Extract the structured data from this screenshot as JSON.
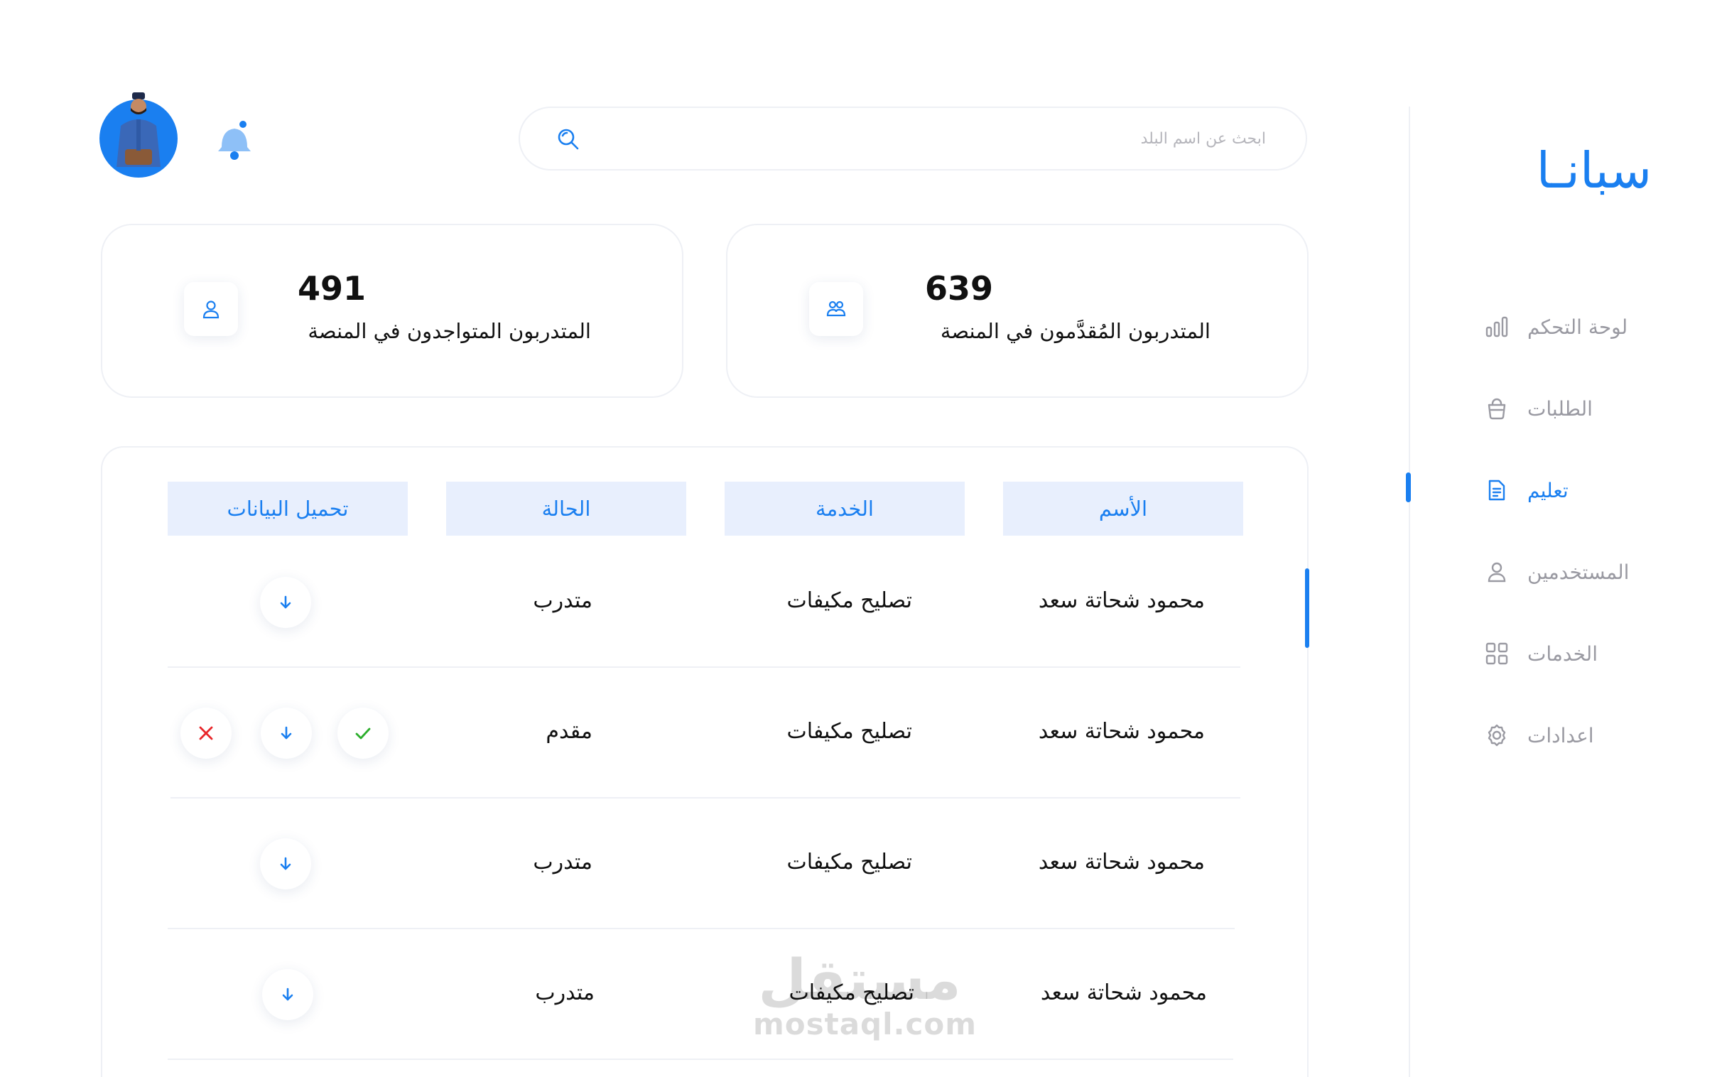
{
  "app": {
    "logo_text": "سبانـا",
    "accent_color": "#1a7ff0"
  },
  "sidebar": {
    "items": [
      {
        "label": "لوحة التحكم",
        "icon": "bar-chart-icon",
        "active": false
      },
      {
        "label": "الطلبات",
        "icon": "bag-icon",
        "active": false
      },
      {
        "label": "تعليم",
        "icon": "document-icon",
        "active": true
      },
      {
        "label": "المستخدمين",
        "icon": "user-icon",
        "active": false
      },
      {
        "label": "الخدمات",
        "icon": "grid-icon",
        "active": false
      },
      {
        "label": "اعدادات",
        "icon": "gear-icon",
        "active": false
      }
    ]
  },
  "header": {
    "search_placeholder": "ابحث عن اسم البلد",
    "search_icon": "search-icon",
    "bell_icon": "bell-icon",
    "avatar": "avatar"
  },
  "stats": {
    "applied": {
      "value": "639",
      "label": "المتدربون المُقدَّمون في المنصة",
      "icon": "users-group-icon"
    },
    "present": {
      "value": "491",
      "label": "المتدربون المتواجدون في المنصة",
      "icon": "user-icon"
    }
  },
  "table": {
    "headers": [
      "الأسم",
      "الخدمة",
      "الحالة",
      "تحميل البيانات"
    ],
    "rows": [
      {
        "name": "محمود شحاتة سعد",
        "service": "تصليح مكيفات",
        "status": "متدرب",
        "actions": [
          "download"
        ]
      },
      {
        "name": "محمود شحاتة سعد",
        "service": "تصليح مكيفات",
        "status": "مقدم",
        "actions": [
          "accept",
          "download",
          "reject"
        ]
      },
      {
        "name": "محمود شحاتة سعد",
        "service": "تصليح مكيفات",
        "status": "متدرب",
        "actions": [
          "download"
        ]
      },
      {
        "name": "محمود شحاتة سعد",
        "service": "تصليح مكيفات",
        "status": "متدرب",
        "actions": [
          "download"
        ]
      }
    ]
  },
  "watermark": {
    "arabic": "مستقل",
    "latin": "mostaql.com"
  }
}
